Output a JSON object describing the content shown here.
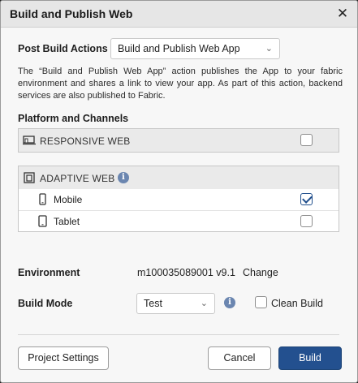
{
  "dialog": {
    "title": "Build and Publish Web",
    "close_glyph": "✕"
  },
  "post_build": {
    "label": "Post Build Actions",
    "selected": "Build and Publish Web App",
    "description": "The “Build and Publish Web App” action publishes the App to your fabric environment and shares a link to view your app. As part of this action, backend services are also published to Fabric."
  },
  "platforms": {
    "label": "Platform and Channels",
    "responsive": {
      "label": "RESPONSIVE WEB",
      "checked": false
    },
    "adaptive": {
      "label": "ADAPTIVE WEB",
      "channels": [
        {
          "label": "Mobile",
          "icon": "mobile-icon",
          "checked": true
        },
        {
          "label": "Tablet",
          "icon": "tablet-icon",
          "checked": false
        }
      ]
    }
  },
  "environment": {
    "label": "Environment",
    "value": "m100035089001 v9.1",
    "change_link": "Change"
  },
  "build_mode": {
    "label": "Build Mode",
    "selected": "Test",
    "clean_build_label": "Clean Build",
    "clean_build_checked": false
  },
  "footer": {
    "project_settings": "Project Settings",
    "cancel": "Cancel",
    "build": "Build"
  },
  "colors": {
    "primary": "#23508f",
    "title_bar": "#e6e6e6",
    "checkbox_checked": "#1f4e8c"
  }
}
